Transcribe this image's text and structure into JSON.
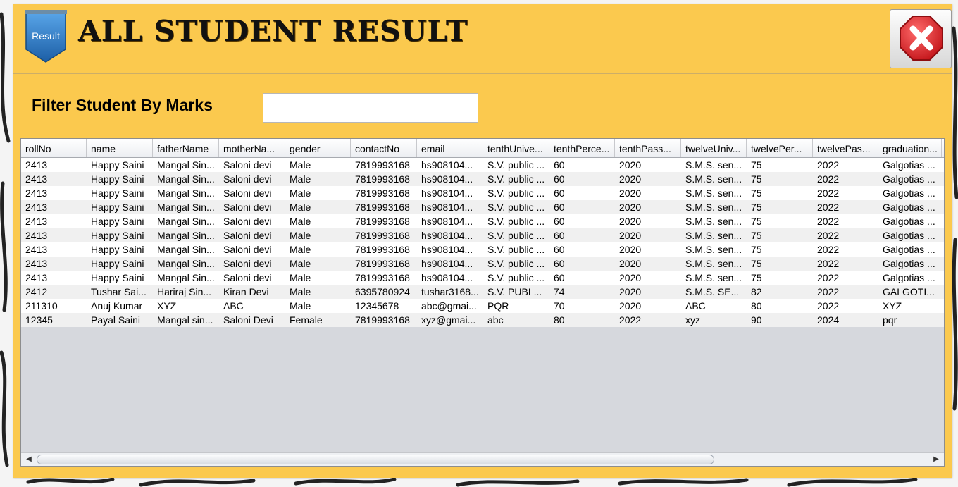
{
  "window": {
    "title": "ALL STUDENT RESULT",
    "badge_text": "Result",
    "close_icon": "close-icon"
  },
  "filter": {
    "label": "Filter Student By Marks",
    "value": "",
    "placeholder": ""
  },
  "table": {
    "columns": [
      "rollNo",
      "name",
      "fatherName",
      "motherNa...",
      "gender",
      "contactNo",
      "email",
      "tenthUnive...",
      "tenthPerce...",
      "tenthPass...",
      "twelveUniv...",
      "twelvePer...",
      "twelvePas...",
      "graduation..."
    ],
    "rows": [
      [
        "2413",
        "Happy Saini",
        "Mangal Sin...",
        "Saloni devi",
        "Male",
        "7819993168",
        "hs908104...",
        "S.V. public ...",
        "60",
        "2020",
        "S.M.S. sen...",
        "75",
        "2022",
        "Galgotias ..."
      ],
      [
        "2413",
        "Happy Saini",
        "Mangal Sin...",
        "Saloni devi",
        "Male",
        "7819993168",
        "hs908104...",
        "S.V. public ...",
        "60",
        "2020",
        "S.M.S. sen...",
        "75",
        "2022",
        "Galgotias ..."
      ],
      [
        "2413",
        "Happy Saini",
        "Mangal Sin...",
        "Saloni devi",
        "Male",
        "7819993168",
        "hs908104...",
        "S.V. public ...",
        "60",
        "2020",
        "S.M.S. sen...",
        "75",
        "2022",
        "Galgotias ..."
      ],
      [
        "2413",
        "Happy Saini",
        "Mangal Sin...",
        "Saloni devi",
        "Male",
        "7819993168",
        "hs908104...",
        "S.V. public ...",
        "60",
        "2020",
        "S.M.S. sen...",
        "75",
        "2022",
        "Galgotias ..."
      ],
      [
        "2413",
        "Happy Saini",
        "Mangal Sin...",
        "Saloni devi",
        "Male",
        "7819993168",
        "hs908104...",
        "S.V. public ...",
        "60",
        "2020",
        "S.M.S. sen...",
        "75",
        "2022",
        "Galgotias ..."
      ],
      [
        "2413",
        "Happy Saini",
        "Mangal Sin...",
        "Saloni devi",
        "Male",
        "7819993168",
        "hs908104...",
        "S.V. public ...",
        "60",
        "2020",
        "S.M.S. sen...",
        "75",
        "2022",
        "Galgotias ..."
      ],
      [
        "2413",
        "Happy Saini",
        "Mangal Sin...",
        "Saloni devi",
        "Male",
        "7819993168",
        "hs908104...",
        "S.V. public ...",
        "60",
        "2020",
        "S.M.S. sen...",
        "75",
        "2022",
        "Galgotias ..."
      ],
      [
        "2413",
        "Happy Saini",
        "Mangal Sin...",
        "Saloni devi",
        "Male",
        "7819993168",
        "hs908104...",
        "S.V. public ...",
        "60",
        "2020",
        "S.M.S. sen...",
        "75",
        "2022",
        "Galgotias ..."
      ],
      [
        "2413",
        "Happy Saini",
        "Mangal Sin...",
        "Saloni devi",
        "Male",
        "7819993168",
        "hs908104...",
        "S.V. public ...",
        "60",
        "2020",
        "S.M.S. sen...",
        "75",
        "2022",
        "Galgotias ..."
      ],
      [
        "2412",
        "Tushar Sai...",
        "Hariraj Sin...",
        "Kiran Devi",
        "Male",
        "6395780924",
        "tushar3168...",
        "S.V. PUBL...",
        "74",
        "2020",
        "S.M.S. SE...",
        "82",
        "2022",
        "GALGOTI..."
      ],
      [
        "211310",
        "Anuj Kumar",
        "XYZ",
        "ABC",
        "Male",
        "12345678",
        "abc@gmai...",
        "PQR",
        "70",
        "2020",
        "ABC",
        "80",
        "2022",
        "XYZ"
      ],
      [
        "12345",
        "Payal Saini",
        "Mangal sin...",
        "Saloni Devi",
        "Female",
        "7819993168",
        "xyz@gmai...",
        "abc",
        "80",
        "2022",
        "xyz",
        "90",
        "2024",
        "pqr"
      ]
    ]
  },
  "scrollbar": {
    "left_arrow": "◀",
    "right_arrow": "▶",
    "position": 0,
    "visible_fraction": 0.76
  },
  "colors": {
    "panel": "#fbc94e",
    "close_red": "#e3262b",
    "badge_blue": "#2f7fc8"
  }
}
